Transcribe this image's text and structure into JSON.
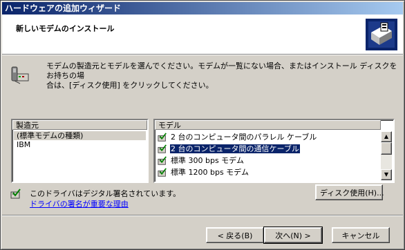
{
  "window": {
    "title": "ハードウェアの追加ウィザード"
  },
  "header": {
    "title": "新しいモデムのインストール",
    "icon": "hardware-wizard-icon"
  },
  "instructions": {
    "icon": "modem-icon",
    "text": "モデムの製造元とモデルを選んでください。モデムが一覧にない場合、またはインストール ディスクをお持ちの場\n合は、[ディスク使用] をクリックしてください。"
  },
  "manufacturer_list": {
    "header": "製造元",
    "items": [
      {
        "label": "(標準モデムの種類)",
        "selected": true
      },
      {
        "label": "IBM",
        "selected": false
      }
    ]
  },
  "model_list": {
    "header": "モデル",
    "items": [
      {
        "label": "2 台のコンピュータ間のパラレル ケーブル",
        "selected": false
      },
      {
        "label": "2 台のコンピュータ間の通信ケーブル",
        "selected": true
      },
      {
        "label": "標準   300 bps モデム",
        "selected": false
      },
      {
        "label": "標準   1200 bps モデム",
        "selected": false
      }
    ],
    "item_icon": "signed-driver-icon"
  },
  "signature": {
    "icon": "signed-driver-icon",
    "text": "このドライバはデジタル署名されています。",
    "link": "ドライバの署名が重要な理由"
  },
  "buttons": {
    "have_disk": "ディスク使用(H)...",
    "back": "< 戻る(B)",
    "next": "次へ(N) >",
    "cancel": "キャンセル"
  },
  "colors": {
    "title_gradient_start": "#0a246a",
    "title_gradient_end": "#a6caf0",
    "selection": "#0a246a",
    "face": "#d4d0c8",
    "link": "#0000ff"
  }
}
